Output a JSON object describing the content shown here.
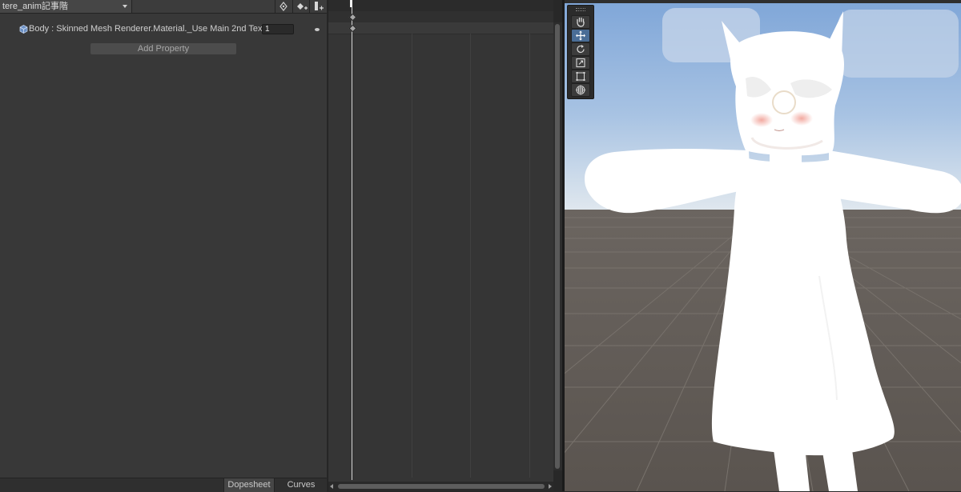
{
  "animation_panel": {
    "clip_name": "tere_anim記事階",
    "toolbar_icons": [
      "add-event-point-icon",
      "add-keyframe-icon",
      "add-event-icon"
    ],
    "property": {
      "icon": "skinned-mesh-renderer-icon",
      "label": "Body : Skinned Mesh Renderer.Material._Use Main 2nd Tex",
      "value": "1"
    },
    "add_property_label": "Add Property",
    "tabs": [
      {
        "label": "Dopesheet",
        "active": true
      },
      {
        "label": "Curves",
        "active": false
      }
    ]
  },
  "dopesheet": {
    "keyframes": [
      "summary-keyframe",
      "property-keyframe"
    ]
  },
  "scene_view": {
    "tools": [
      {
        "name": "hand-tool",
        "active": false
      },
      {
        "name": "move-tool",
        "active": true
      },
      {
        "name": "rotate-tool",
        "active": false
      },
      {
        "name": "scale-tool",
        "active": false
      },
      {
        "name": "rect-tool",
        "active": false
      },
      {
        "name": "transform-tool",
        "active": false
      }
    ],
    "colors": {
      "sky_top": "#7fa6d8",
      "sky_horizon": "#dfe7ee",
      "ground": "#5e5852",
      "accent_active_tool": "#4a6d96"
    }
  }
}
